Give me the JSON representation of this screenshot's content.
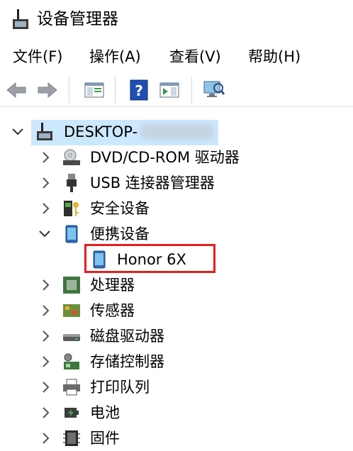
{
  "window": {
    "title": "设备管理器"
  },
  "menu": {
    "file": "文件(F)",
    "action": "操作(A)",
    "view": "查看(V)",
    "help": "帮助(H)"
  },
  "tree": {
    "root": "DESKTOP-",
    "categories": [
      {
        "label": "DVD/CD-ROM 驱动器"
      },
      {
        "label": "USB 连接器管理器"
      },
      {
        "label": "安全设备"
      },
      {
        "label": "便携设备",
        "child": "Honor 6X"
      },
      {
        "label": "处理器"
      },
      {
        "label": "传感器"
      },
      {
        "label": "磁盘驱动器"
      },
      {
        "label": "存储控制器"
      },
      {
        "label": "打印队列"
      },
      {
        "label": "电池"
      },
      {
        "label": "固件"
      }
    ]
  },
  "colors": {
    "selection": "#cce8ff",
    "annotation_box": "#e32020",
    "help_icon": "#1f4fb4"
  }
}
